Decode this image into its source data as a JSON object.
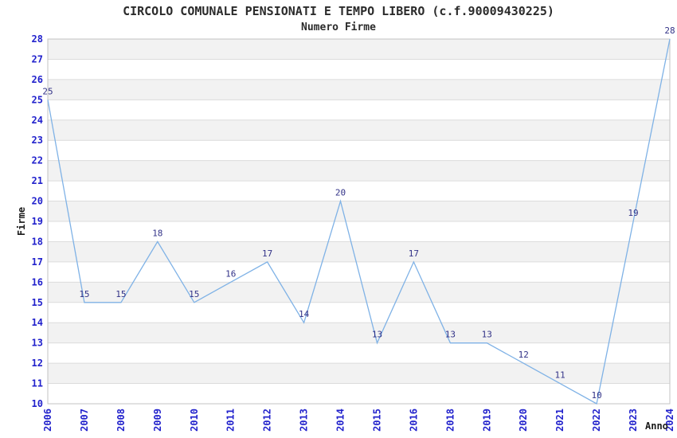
{
  "chart_data": {
    "type": "line",
    "title": "CIRCOLO COMUNALE PENSIONATI E TEMPO LIBERO (c.f.90009430225)",
    "subtitle": "Numero Firme",
    "xlabel": "Anno",
    "ylabel": "Firme",
    "categories": [
      "2006",
      "2007",
      "2008",
      "2009",
      "2010",
      "2011",
      "2012",
      "2013",
      "2014",
      "2015",
      "2016",
      "2018",
      "2019",
      "2020",
      "2021",
      "2022",
      "2023",
      "2024"
    ],
    "values": [
      25,
      15,
      15,
      18,
      15,
      16,
      17,
      14,
      20,
      13,
      17,
      13,
      13,
      12,
      11,
      10,
      19,
      28
    ],
    "ylim": [
      10,
      28
    ],
    "ytick_step": 1,
    "legend": "none",
    "grid": "horizontal gridlines with alternating gray bands",
    "data_labels_visible": true,
    "colors": {
      "line": "#7fb2e6",
      "data_label": "#333388",
      "tick_label": "#2222cc",
      "band_fill": "#f2f2f2",
      "gridline": "#dcdcdc",
      "plot_border": "#c3c3c3",
      "title_text": "#2b2b2b",
      "background": "#ffffff"
    }
  }
}
